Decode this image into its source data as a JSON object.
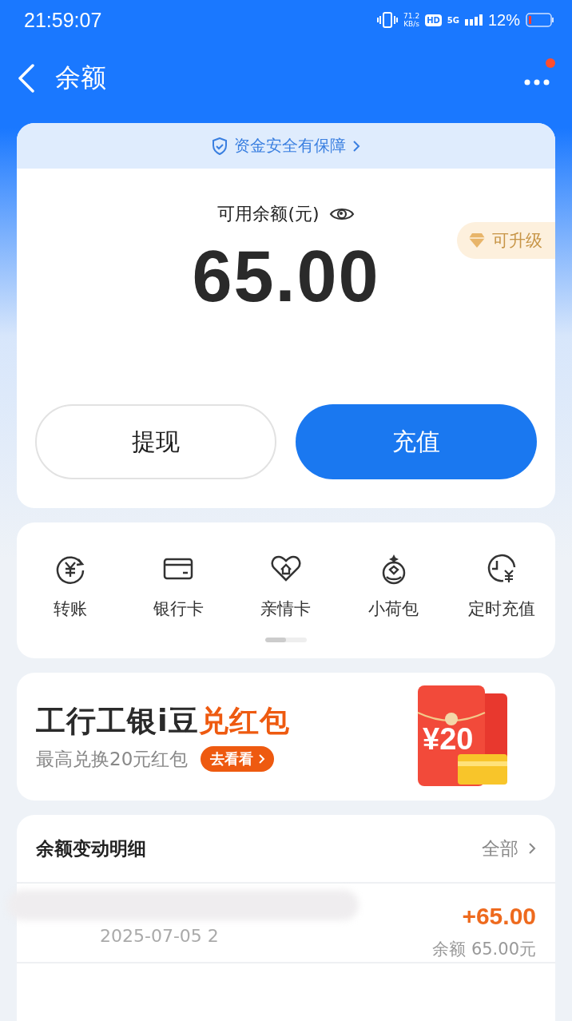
{
  "status_bar": {
    "time": "21:59:07",
    "speed": "71.2",
    "speed_unit": "KB/s",
    "hd": "HD",
    "network": "5G",
    "battery": "12%"
  },
  "header": {
    "title": "余额",
    "has_notification": true
  },
  "balance_card": {
    "banner": "资金安全有保障",
    "label": "可用余额(元)",
    "amount": "65.00",
    "badge": "可升级",
    "buttons": [
      {
        "label": "提现",
        "kind": "secondary"
      },
      {
        "label": "充值",
        "kind": "primary"
      }
    ]
  },
  "shortcuts": {
    "items": [
      {
        "label": "转账",
        "kind": "transfer"
      },
      {
        "label": "银行卡",
        "kind": "card"
      },
      {
        "label": "亲情卡",
        "kind": "family"
      },
      {
        "label": "小荷包",
        "kind": "pouch"
      },
      {
        "label": "定时充值",
        "kind": "scheduled"
      }
    ],
    "page_indicator": {
      "level": 0.5
    }
  },
  "promo": {
    "title_plain": "工行工银i豆",
    "title_highlight": "兑红包",
    "subtitle": "最高兑换20元红包",
    "action": "去看看",
    "art_label": "¥20"
  },
  "details": {
    "title": "余额变动明细",
    "link": "全部",
    "rows": [
      {
        "amount": "+65.00",
        "date": "2025-07-05 2",
        "balance": "余额 65.00元"
      }
    ]
  }
}
